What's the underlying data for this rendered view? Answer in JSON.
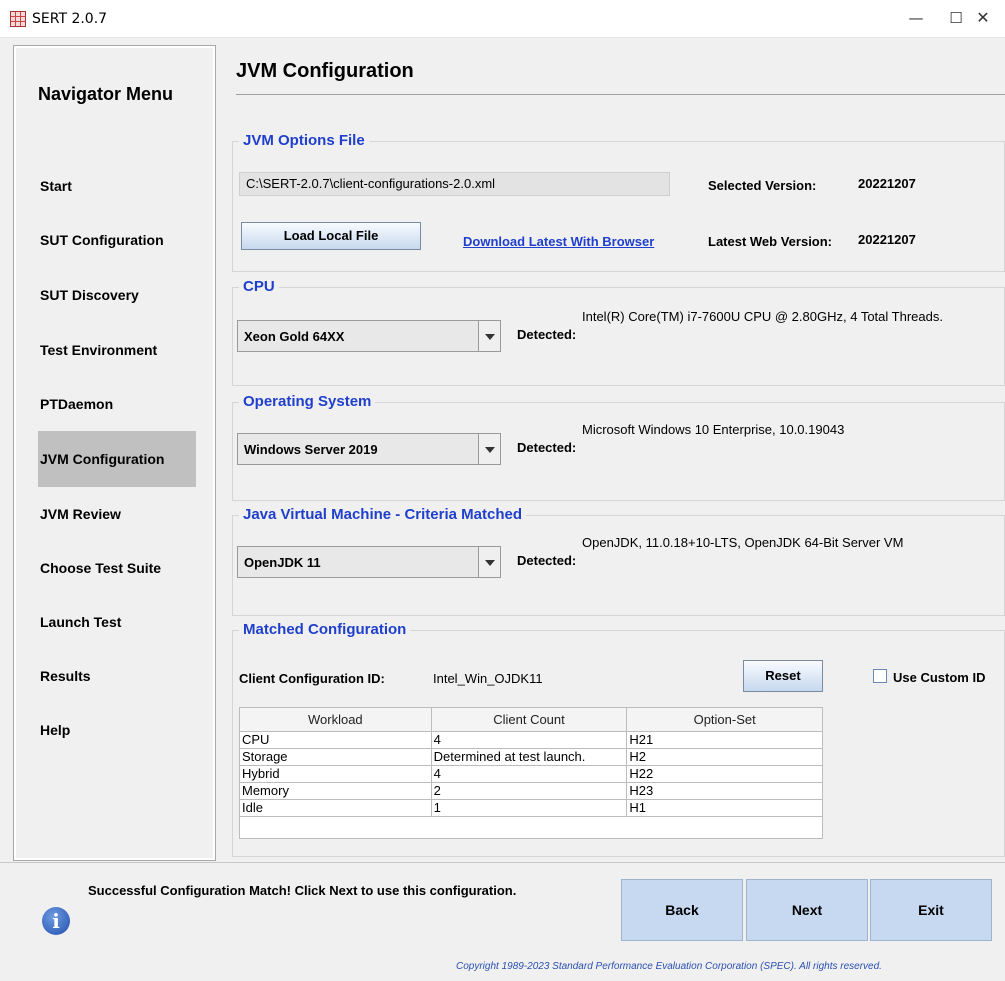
{
  "window": {
    "title": "SERT 2.0.7",
    "minimize": "—",
    "maximize": "☐",
    "close": "✕"
  },
  "nav": {
    "title": "Navigator Menu",
    "items": [
      "Start",
      "SUT Configuration",
      "SUT Discovery",
      "Test Environment",
      "PTDaemon",
      "JVM Configuration",
      "JVM Review",
      "Choose Test Suite",
      "Launch Test",
      "Results",
      "Help"
    ],
    "active": "JVM Configuration"
  },
  "page": {
    "title": "JVM Configuration"
  },
  "jvm_options": {
    "legend": "JVM Options File",
    "path": "C:\\SERT-2.0.7\\client-configurations-2.0.xml",
    "selected_version_label": "Selected Version:",
    "selected_version": "20221207",
    "load_button": "Load Local File",
    "download_link": "Download Latest With Browser",
    "latest_web_version_label": "Latest Web Version:",
    "latest_web_version": "20221207"
  },
  "cpu": {
    "legend": "CPU",
    "selected": "Xeon Gold 64XX",
    "detected_label": "Detected:",
    "detected": "Intel(R) Core(TM) i7-7600U CPU @ 2.80GHz, 4 Total Threads."
  },
  "os": {
    "legend": "Operating System",
    "selected": "Windows Server 2019",
    "detected_label": "Detected:",
    "detected": "Microsoft Windows 10 Enterprise, 10.0.19043"
  },
  "jvm": {
    "legend": "Java Virtual Machine - Criteria Matched",
    "selected": "OpenJDK 11",
    "detected_label": "Detected:",
    "detected": "OpenJDK, 11.0.18+10-LTS, OpenJDK 64-Bit Server VM"
  },
  "matched": {
    "legend": "Matched Configuration",
    "client_id_label": "Client Configuration ID:",
    "client_id": "Intel_Win_OJDK11",
    "reset_button": "Reset",
    "custom_id_label": "Use Custom ID",
    "custom_id_checked": false,
    "table": {
      "headers": [
        "Workload",
        "Client Count",
        "Option-Set"
      ],
      "rows": [
        [
          "CPU",
          "4",
          "H21"
        ],
        [
          "Storage",
          "Determined at test launch.",
          "H2"
        ],
        [
          "Hybrid",
          "4",
          "H22"
        ],
        [
          "Memory",
          "2",
          "H23"
        ],
        [
          "Idle",
          "1",
          "H1"
        ]
      ]
    }
  },
  "footer": {
    "info_icon": "info-icon",
    "status": "Successful Configuration Match! Click Next to use this configuration.",
    "back": "Back",
    "next": "Next",
    "exit": "Exit",
    "copyright": "Copyright 1989-2023 Standard Performance Evaluation Corporation (SPEC). All rights reserved."
  }
}
